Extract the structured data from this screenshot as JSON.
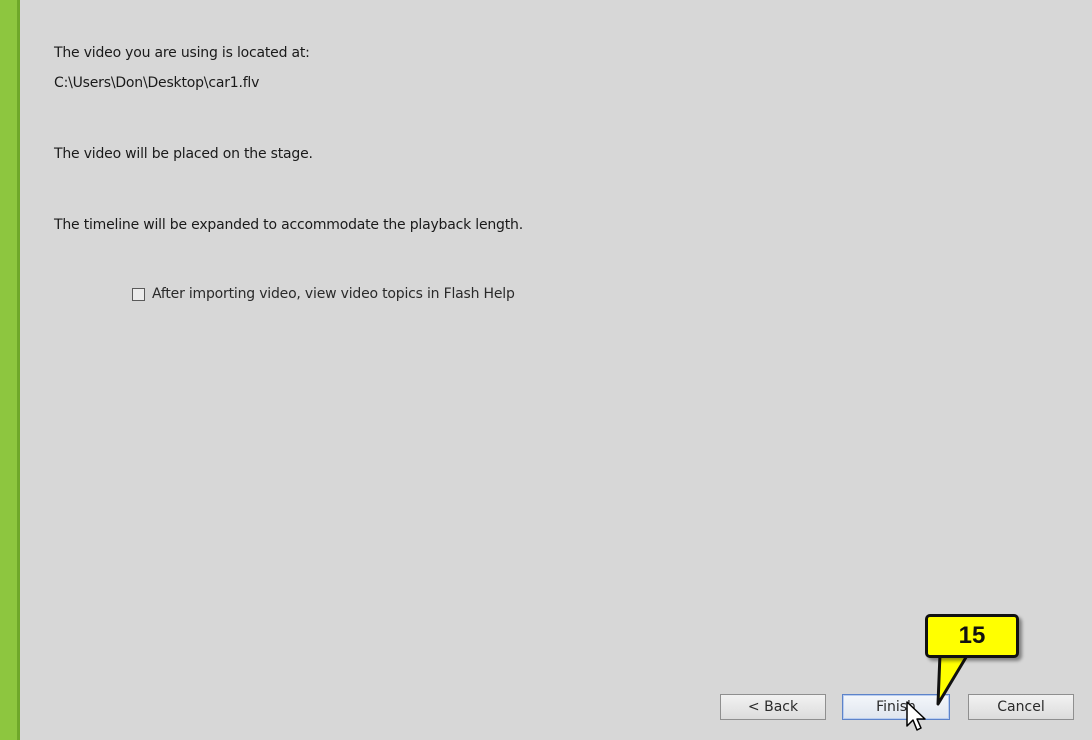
{
  "summary": {
    "location_label": "The video you are using is located at:",
    "file_path": "C:\\Users\\Don\\Desktop\\car1.flv",
    "placement_text": "The video will be placed on the stage.",
    "timeline_text": "The timeline will be expanded to accommodate the playback length."
  },
  "options": {
    "help_checkbox_label": "After importing video, view video topics in Flash Help",
    "help_checkbox_checked": false
  },
  "buttons": {
    "back": "< Back",
    "finish": "Finish",
    "cancel": "Cancel"
  },
  "annotation": {
    "step_number": "15"
  },
  "colors": {
    "accent_bar": "#8dc63f",
    "panel_background": "#d7d7d7",
    "callout_fill": "#ffff00"
  }
}
